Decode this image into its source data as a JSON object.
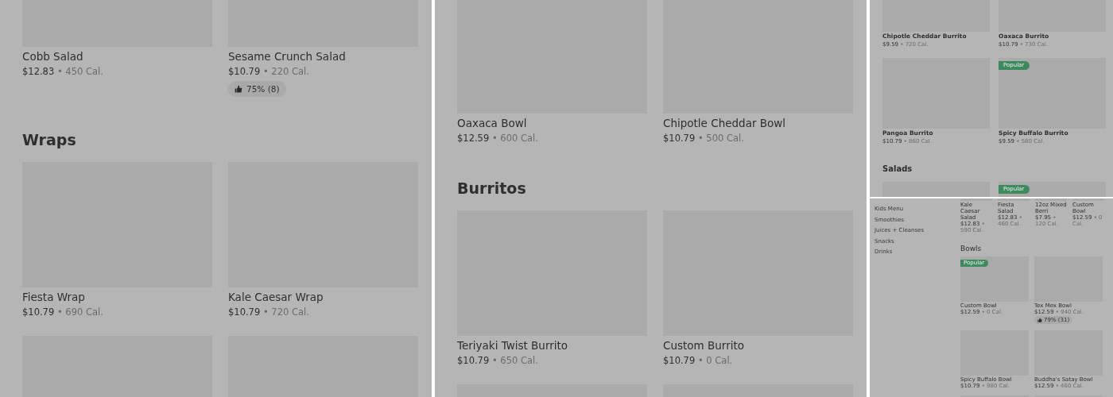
{
  "panels": [
    {
      "sections": [
        {
          "rows": [
            [
              {
                "kind": "item",
                "name": "Cobb Salad",
                "price": "$12.83",
                "calories": "• 450 Cal."
              },
              {
                "kind": "item",
                "name": "Sesame Crunch Salad",
                "price": "$10.79",
                "calories": "• 220 Cal.",
                "rating": "75% (8)"
              }
            ]
          ]
        },
        {
          "heading": "Wraps",
          "rows": [
            [
              {
                "kind": "item",
                "name": "Fiesta Wrap",
                "price": "$10.79",
                "calories": "• 690 Cal."
              },
              {
                "kind": "item",
                "name": "Kale Caesar Wrap",
                "price": "$10.79",
                "calories": "• 720 Cal."
              }
            ],
            [
              {
                "kind": "picture"
              },
              {
                "kind": "picture"
              }
            ]
          ]
        }
      ]
    },
    {
      "sections": [
        {
          "rows": [
            [
              {
                "kind": "item",
                "name": "Oaxaca Bowl",
                "price": "$12.59",
                "calories": "• 600 Cal."
              },
              {
                "kind": "item",
                "name": "Chipotle Cheddar Bowl",
                "price": "$10.79",
                "calories": "• 500 Cal."
              }
            ]
          ]
        },
        {
          "heading": "Burritos",
          "rows": [
            [
              {
                "kind": "item",
                "name": "Teriyaki Twist Burrito",
                "price": "$10.79",
                "calories": "• 650 Cal."
              },
              {
                "kind": "item",
                "name": "Custom Burrito",
                "price": "$10.79",
                "calories": "• 0 Cal."
              }
            ],
            [
              {
                "kind": "picture"
              },
              {
                "kind": "picture"
              }
            ]
          ]
        }
      ]
    },
    {
      "sections": [
        {
          "rows": [
            [
              {
                "kind": "item",
                "name": "Chipotle Cheddar Burrito",
                "price": "$9.59",
                "calories": "• 720 Cal."
              },
              {
                "kind": "item",
                "name": "Oaxaca Burrito",
                "price": "$10.79",
                "calories": "• 730 Cal."
              }
            ],
            [
              {
                "kind": "item",
                "name": "Pangoa Burrito",
                "price": "$10.79",
                "calories": "• 860 Cal."
              },
              {
                "kind": "item",
                "name": "Spicy Buffalo Burrito",
                "price": "$9.59",
                "calories": "• 580 Cal.",
                "badge": "Popular"
              }
            ]
          ]
        },
        {
          "heading": "Salads",
          "rows": [
            [
              {
                "kind": "picture"
              },
              {
                "kind": "picture",
                "badge": "Popular"
              }
            ]
          ]
        }
      ]
    },
    {
      "sidebar": {
        "items": [
          "Kids Menu",
          "Smoothies",
          "Juices + Cleanses",
          "Snacks",
          "Drinks"
        ]
      },
      "sections": [
        {
          "kind": "carousel",
          "rows": [
            [
              {
                "kind": "item",
                "name": "Kale Caesar Salad",
                "price": "$12.83",
                "calories": "• 590 Cal."
              },
              {
                "kind": "item",
                "name": "Fiesta Salad",
                "price": "$12.83",
                "calories": "• 460 Cal."
              },
              {
                "kind": "item",
                "name": "12oz Mixed Berri",
                "price": "$7.95",
                "calories": "• 120 Cal."
              },
              {
                "kind": "item",
                "name": "Custom Bowl",
                "price": "$12.59",
                "calories": "• 0 Cal."
              }
            ]
          ]
        },
        {
          "heading": "Bowls",
          "rows": [
            [
              {
                "kind": "item",
                "name": "Custom Bowl",
                "price": "$12.59",
                "calories": "• 0 Cal.",
                "badge": "Popular"
              },
              {
                "kind": "item",
                "name": "Tex Mex Bowl",
                "price": "$12.59",
                "calories": "• 940 Cal.",
                "rating": "79% (31)"
              }
            ],
            [
              {
                "kind": "item",
                "name": "Spicy Buffalo Bowl",
                "price": "$10.79",
                "calories": "• 980 Cal."
              },
              {
                "kind": "item",
                "name": "Buddha's Satay Bowl",
                "price": "$12.59",
                "calories": "• 460 Cal."
              }
            ],
            [
              {
                "kind": "picture"
              },
              {
                "kind": "picture"
              }
            ]
          ]
        }
      ]
    }
  ]
}
